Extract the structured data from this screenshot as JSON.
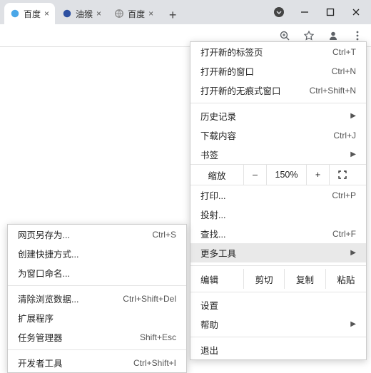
{
  "tabs": [
    {
      "title": "百度",
      "favicon_color": "#4aa7e8"
    },
    {
      "title": "油猴",
      "favicon_color": "#2e51a2"
    },
    {
      "title": "百度",
      "favicon_color": "#888888"
    }
  ],
  "toolbar": {
    "zoom_icon": "zoom",
    "star_icon": "star",
    "profile_icon": "profile",
    "menu_icon": "menu"
  },
  "mainmenu": {
    "new_tab": "打开新的标签页",
    "new_tab_sc": "Ctrl+T",
    "new_window": "打开新的窗口",
    "new_window_sc": "Ctrl+N",
    "new_incognito": "打开新的无痕式窗口",
    "new_incognito_sc": "Ctrl+Shift+N",
    "history": "历史记录",
    "downloads": "下载内容",
    "downloads_sc": "Ctrl+J",
    "bookmarks": "书签",
    "zoom_label": "缩放",
    "zoom_minus": "–",
    "zoom_value": "150%",
    "zoom_plus": "+",
    "print": "打印...",
    "print_sc": "Ctrl+P",
    "cast": "投射...",
    "find": "查找...",
    "find_sc": "Ctrl+F",
    "more_tools": "更多工具",
    "edit_label": "编辑",
    "cut": "剪切",
    "copy": "复制",
    "paste": "粘贴",
    "settings": "设置",
    "help": "帮助",
    "exit": "退出"
  },
  "submenu": {
    "save_as": "网页另存为...",
    "save_as_sc": "Ctrl+S",
    "create_shortcut": "创建快捷方式...",
    "name_window": "为窗口命名...",
    "clear_data": "清除浏览数据...",
    "clear_data_sc": "Ctrl+Shift+Del",
    "extensions": "扩展程序",
    "task_manager": "任务管理器",
    "task_manager_sc": "Shift+Esc",
    "dev_tools": "开发者工具",
    "dev_tools_sc": "Ctrl+Shift+I"
  }
}
